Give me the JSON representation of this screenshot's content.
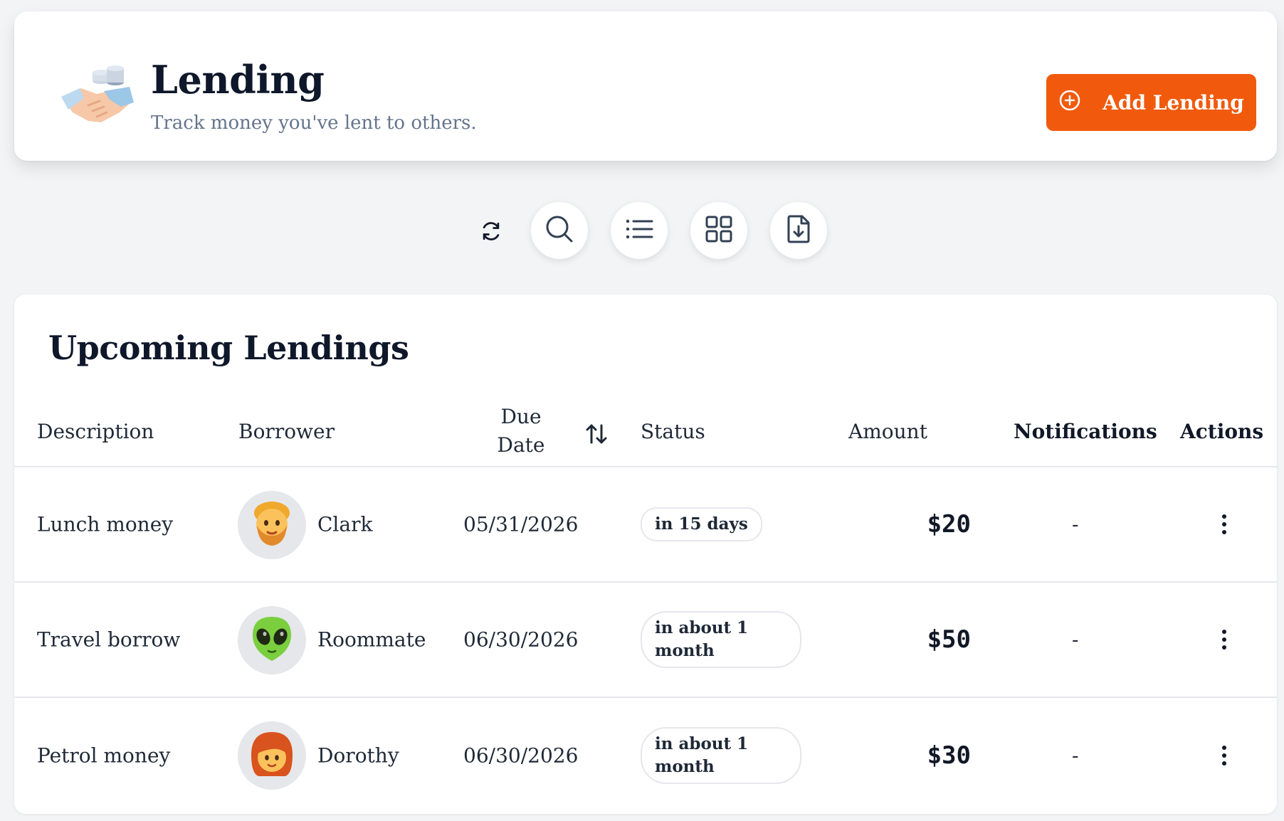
{
  "header": {
    "title": "Lending",
    "subtitle": "Track money you've lent to others.",
    "logo_icon": "handshake-coins-icon",
    "add_button_label": "Add Lending",
    "add_button_icon": "plus-circle-icon"
  },
  "toolbar": {
    "items": [
      "refresh-icon",
      "search-icon",
      "list-view-icon",
      "grid-view-icon",
      "export-file-icon"
    ]
  },
  "table": {
    "title": "Upcoming Lendings",
    "columns": {
      "description": "Description",
      "borrower": "Borrower",
      "due_date_line1": "Due",
      "due_date_line2": "Date",
      "status": "Status",
      "amount": "Amount",
      "notifications": "Notifications",
      "actions": "Actions"
    },
    "rows": [
      {
        "description": "Lunch money",
        "borrower": "Clark",
        "avatar": "bearded-person-emoji",
        "due_date": "05/31/2026",
        "status": "in 15 days",
        "amount": "$20",
        "notifications": "-"
      },
      {
        "description": "Travel borrow",
        "borrower": "Roommate",
        "avatar": "alien-emoji",
        "due_date": "06/30/2026",
        "status": "in about 1 month",
        "amount": "$50",
        "notifications": "-"
      },
      {
        "description": "Petrol money",
        "borrower": "Dorothy",
        "avatar": "red-haired-woman-emoji",
        "due_date": "06/30/2026",
        "status": "in about 1 month",
        "amount": "$30",
        "notifications": "-"
      }
    ]
  },
  "colors": {
    "accent": "#f15a0c",
    "page_bg": "#f3f4f6",
    "card_bg": "#ffffff",
    "subtitle": "#64748b",
    "icon_stroke": "#334155"
  }
}
